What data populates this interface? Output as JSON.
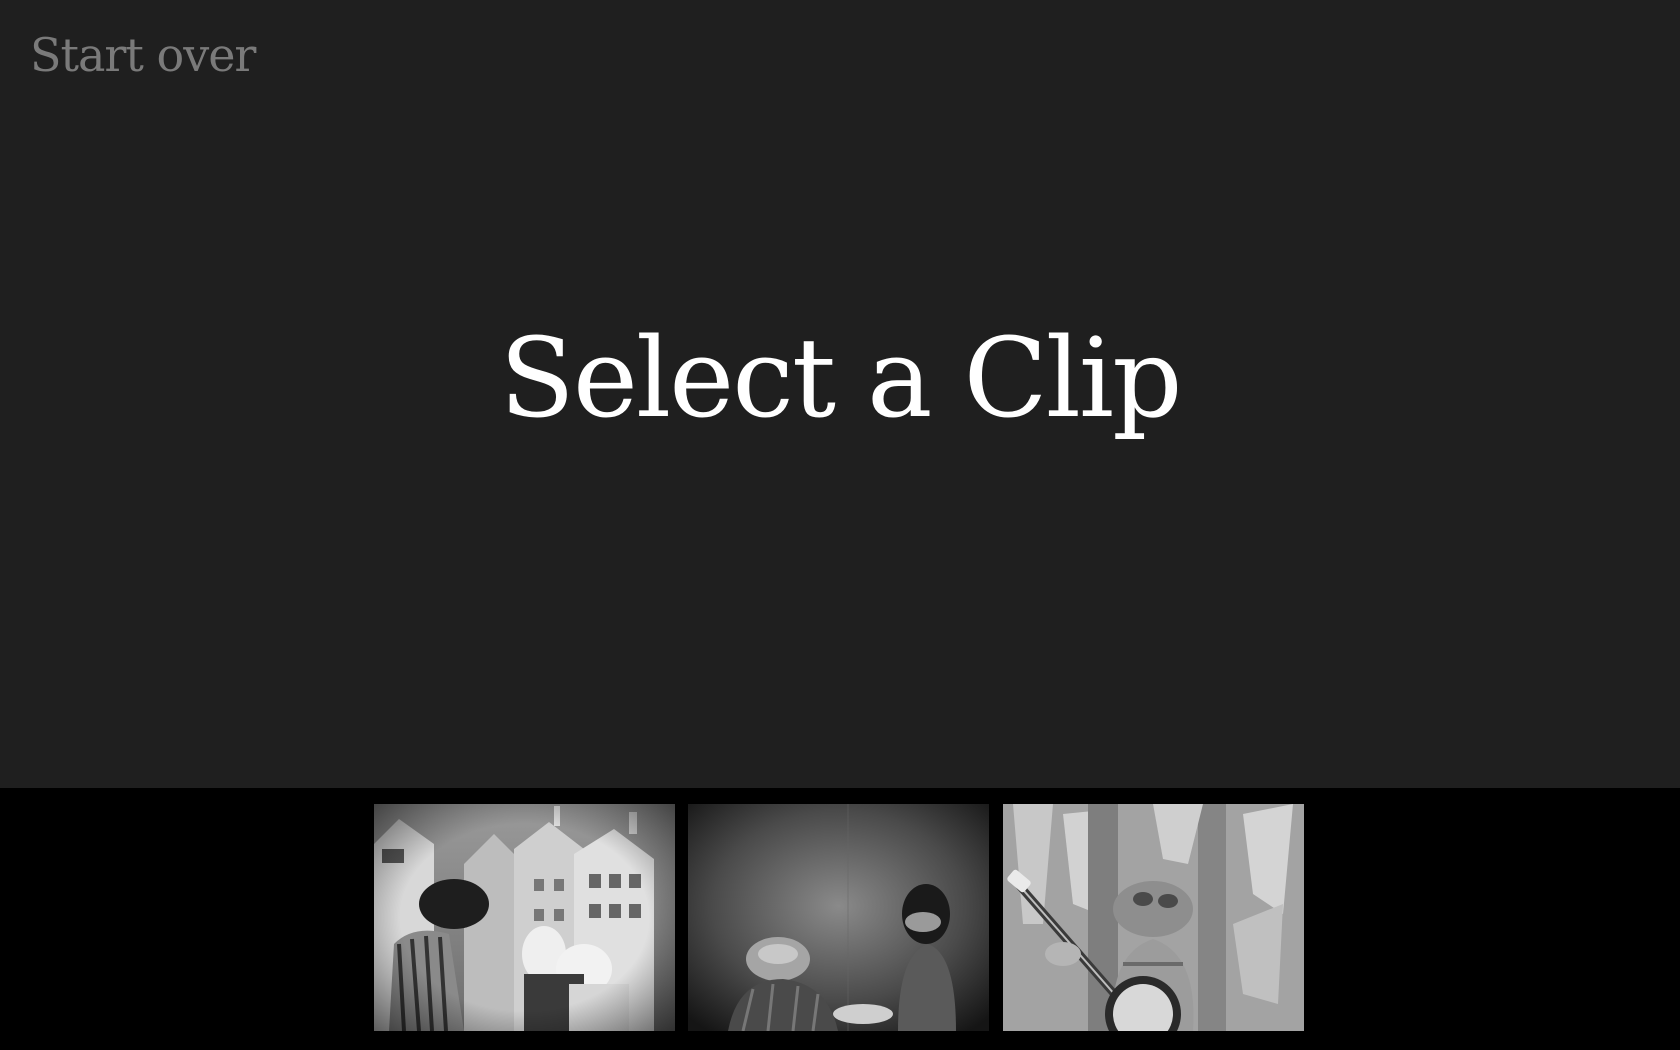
{
  "nav": {
    "start_over_label": "Start over"
  },
  "main": {
    "title": "Select a Clip"
  },
  "clips": [
    {
      "thumbnail_icon": "clip-thumbnail-street-puppets"
    },
    {
      "thumbnail_icon": "clip-thumbnail-two-puppets-dark"
    },
    {
      "thumbnail_icon": "clip-thumbnail-frog-banjo"
    }
  ],
  "colors": {
    "background": "#1f1f1f",
    "tray_background": "#000000",
    "title_text": "#ffffff",
    "muted_text": "#7a7a7a"
  }
}
